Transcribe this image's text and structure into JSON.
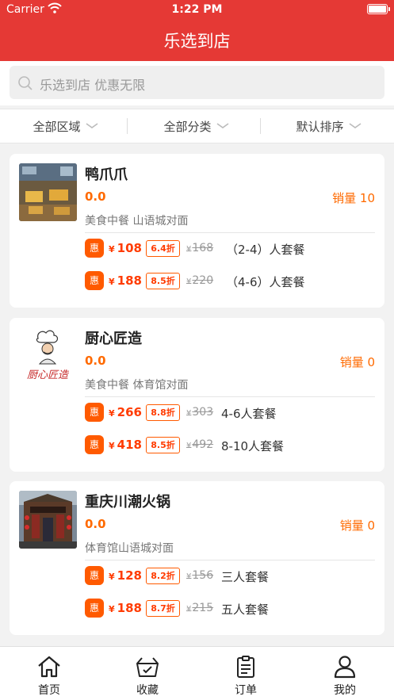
{
  "status_bar": {
    "carrier": "Carrier",
    "time": "1:22 PM"
  },
  "header": {
    "title": "乐选到店"
  },
  "search": {
    "placeholder": "乐选到店 优惠无限"
  },
  "filters": [
    {
      "label": "全部区域"
    },
    {
      "label": "全部分类"
    },
    {
      "label": "默认排序"
    }
  ],
  "stores": [
    {
      "name": "鸭爪爪",
      "price": "0.0",
      "sales": "销量 10",
      "address": "美食中餐 山语城对面",
      "deals": [
        {
          "badge": "惠",
          "currency": "¥",
          "price": "108",
          "discount": "6.4折",
          "orig_currency": "¥",
          "orig_price": "168",
          "name": "（2-4）人套餐"
        },
        {
          "badge": "惠",
          "currency": "¥",
          "price": "188",
          "discount": "8.5折",
          "orig_currency": "¥",
          "orig_price": "220",
          "name": "（4-6）人套餐"
        }
      ]
    },
    {
      "name": "厨心匠造",
      "logo_text": "厨心匠造",
      "price": "0.0",
      "sales": "销量 0",
      "address": "美食中餐 体育馆对面",
      "deals": [
        {
          "badge": "惠",
          "currency": "¥",
          "price": "266",
          "discount": "8.8折",
          "orig_currency": "¥",
          "orig_price": "303",
          "name": "4-6人套餐"
        },
        {
          "badge": "惠",
          "currency": "¥",
          "price": "418",
          "discount": "8.5折",
          "orig_currency": "¥",
          "orig_price": "492",
          "name": "8-10人套餐"
        }
      ]
    },
    {
      "name": "重庆川潮火锅",
      "price": "0.0",
      "sales": "销量 0",
      "address": "体育馆山语城对面",
      "deals": [
        {
          "badge": "惠",
          "currency": "¥",
          "price": "128",
          "discount": "8.2折",
          "orig_currency": "¥",
          "orig_price": "156",
          "name": "三人套餐"
        },
        {
          "badge": "惠",
          "currency": "¥",
          "price": "188",
          "discount": "8.7折",
          "orig_currency": "¥",
          "orig_price": "215",
          "name": "五人套餐"
        }
      ]
    }
  ],
  "tabbar": [
    {
      "label": "首页",
      "icon": "home-icon"
    },
    {
      "label": "收藏",
      "icon": "favorites-basket-icon"
    },
    {
      "label": "订单",
      "icon": "orders-clipboard-icon"
    },
    {
      "label": "我的",
      "icon": "profile-icon"
    }
  ],
  "colors": {
    "brand": "#e53935",
    "accent": "#ff5a00",
    "price": "#ff3b00"
  }
}
